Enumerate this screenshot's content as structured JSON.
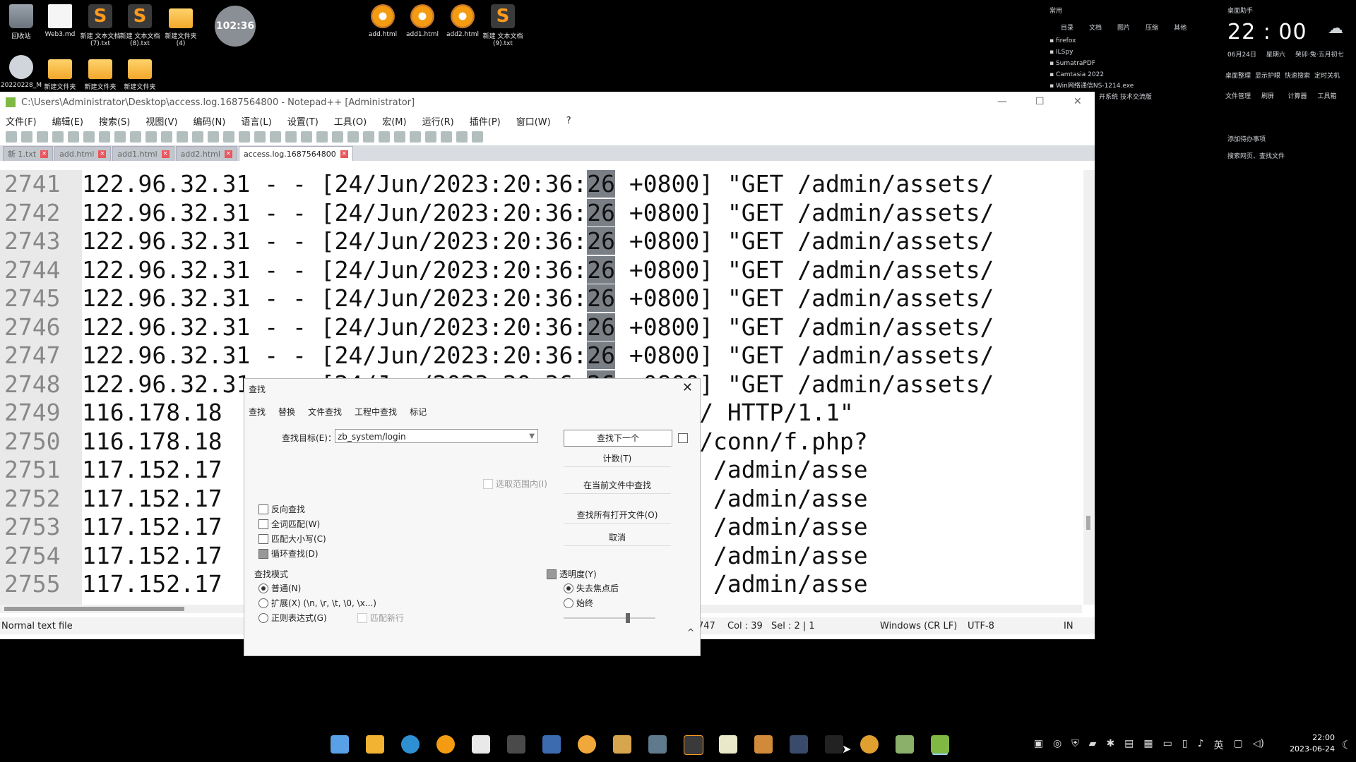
{
  "desktop": {
    "icons": [
      {
        "label": "回收站",
        "kind": "trash"
      },
      {
        "label": "Web3.md",
        "kind": "doc"
      },
      {
        "label": "新建 文本文档 (7).txt",
        "kind": "sublime"
      },
      {
        "label": "新建 文本文档 (8).txt",
        "kind": "sublime"
      },
      {
        "label": "新建文件夹 (4)",
        "kind": "folder"
      },
      {
        "label": "add.html",
        "kind": "chrome"
      },
      {
        "label": "add1.html",
        "kind": "chrome"
      },
      {
        "label": "add2.html",
        "kind": "chrome"
      },
      {
        "label": "新建 文本文档 (9).txt",
        "kind": "sublime"
      },
      {
        "label": "20220228_M",
        "kind": "zip"
      },
      {
        "label": "新建文件夹",
        "kind": "folder"
      },
      {
        "label": "新建文件夹",
        "kind": "folder"
      },
      {
        "label": "新建文件夹",
        "kind": "folder"
      }
    ],
    "clock_bubble": "102:36"
  },
  "widget": {
    "header": "常用",
    "tabs": [
      "目录",
      "文档",
      "图片",
      "压缩",
      "其他"
    ],
    "apps": [
      "firefox",
      "ILSpy",
      "SumatraPDF",
      "Camtasia 2022",
      "Win网络通信NS-1214.exe"
    ],
    "title": "桌面助手",
    "time": "22 : 00",
    "date": "06月24日",
    "weekday": "星期六",
    "lunar": "癸卯·兔·五月初七",
    "tools": [
      "桌面整理",
      "显示护眼",
      "快速搜索",
      "定时关机",
      "文件管理",
      "刷屏",
      "计算器",
      "工具箱"
    ],
    "note1": "添加待办事项",
    "note2": "搜索网页、查找文件",
    "side_text": "开系统 技术交流版"
  },
  "window": {
    "title": "C:\\Users\\Administrator\\Desktop\\access.log.1687564800 - Notepad++ [Administrator]",
    "menu": [
      "文件(F)",
      "编辑(E)",
      "搜索(S)",
      "视图(V)",
      "编码(N)",
      "语言(L)",
      "设置(T)",
      "工具(O)",
      "宏(M)",
      "运行(R)",
      "插件(P)",
      "窗口(W)",
      "?"
    ],
    "tabs": [
      {
        "label": "新 1.txt",
        "active": false
      },
      {
        "label": "add.html",
        "active": false
      },
      {
        "label": "add1.html",
        "active": false
      },
      {
        "label": "add2.html",
        "active": false
      },
      {
        "label": "access.log.1687564800",
        "active": true
      }
    ],
    "lines": [
      {
        "num": "2741",
        "pre": "122.96.32.31 - - [24/Jun/2023:20:36:",
        "hl": "26",
        "post": " +0800] \"GET /admin/assets/"
      },
      {
        "num": "2742",
        "pre": "122.96.32.31 - - [24/Jun/2023:20:36:",
        "hl": "26",
        "post": " +0800] \"GET /admin/assets/"
      },
      {
        "num": "2743",
        "pre": "122.96.32.31 - - [24/Jun/2023:20:36:",
        "hl": "26",
        "post": " +0800] \"GET /admin/assets/"
      },
      {
        "num": "2744",
        "pre": "122.96.32.31 - - [24/Jun/2023:20:36:",
        "hl": "26",
        "post": " +0800] \"GET /admin/assets/"
      },
      {
        "num": "2745",
        "pre": "122.96.32.31 - - [24/Jun/2023:20:36:",
        "hl": "26",
        "post": " +0800] \"GET /admin/assets/"
      },
      {
        "num": "2746",
        "pre": "122.96.32.31 - - [24/Jun/2023:20:36:",
        "hl": "26",
        "post": " +0800] \"GET /admin/assets/"
      },
      {
        "num": "2747",
        "pre": "122.96.32.31 - - [24/Jun/2023:20:36:",
        "hl": "26",
        "post": " +0800] \"GET /admin/assets/"
      },
      {
        "num": "2748",
        "pre": "122.96.32.31 - - [24/Jun/2023:20:36:",
        "hl": "26",
        "post": " +0800] \"GET /admin/assets/"
      },
      {
        "num": "2749",
        "pre": "116.178.18",
        "hl": "",
        "post": "                      +0800] \"GET / HTTP/1.1\""
      },
      {
        "num": "2750",
        "pre": "116.178.18",
        "hl": "",
        "post": "                      +0800] \"GET /conn/f.php?"
      },
      {
        "num": "2751",
        "pre": "117.152.17",
        "hl": "",
        "post": "                     8 +0800] \"GET /admin/asse"
      },
      {
        "num": "2752",
        "pre": "117.152.17",
        "hl": "",
        "post": "                     8 +0800] \"GET /admin/asse"
      },
      {
        "num": "2753",
        "pre": "117.152.17",
        "hl": "",
        "post": "                     8 +0800] \"GET /admin/asse"
      },
      {
        "num": "2754",
        "pre": "117.152.17",
        "hl": "",
        "post": "                     8 +0800] \"GET /admin/asse"
      },
      {
        "num": "2755",
        "pre": "117.152.17",
        "hl": "",
        "post": "                     8 +0800] \"GET /admin/asse"
      }
    ],
    "status": {
      "filetype": "Normal text file",
      "line": "747",
      "col": "Col : 39",
      "sel": "Sel : 2 | 1",
      "eol": "Windows (CR LF)",
      "encoding": "UTF-8",
      "mode": "IN"
    }
  },
  "find_dialog": {
    "title": "查找",
    "tabs": [
      "查找",
      "替换",
      "文件查找",
      "工程中查找",
      "标记"
    ],
    "target_label": "查找目标(E)：",
    "target_value": "zb_system/login",
    "buttons": [
      "查找下一个",
      "计数(T)",
      "在当前文件中查找",
      "查找所有打开文件(O)",
      "取消"
    ],
    "in_selection": "选取范围内(I)",
    "options": [
      {
        "label": "反向查找",
        "checked": false
      },
      {
        "label": "全词匹配(W)",
        "checked": false
      },
      {
        "label": "匹配大小写(C)",
        "checked": false
      },
      {
        "label": "循环查找(D)",
        "checked": true
      }
    ],
    "mode_title": "查找模式",
    "modes": [
      {
        "label": "普通(N)",
        "checked": true
      },
      {
        "label": "扩展(X) (\\n, \\r, \\t, \\0, \\x...)",
        "checked": false
      },
      {
        "label": "正则表达式(G)",
        "checked": false
      }
    ],
    "match_newline": "匹配新行",
    "transparency": "透明度(Y)",
    "trans_options": [
      {
        "label": "失去焦点后",
        "checked": true
      },
      {
        "label": "始终",
        "checked": false
      }
    ],
    "transparency_level": 0.7
  },
  "taskbar": {
    "time": "22:00",
    "date": "2023-06-24",
    "ime": "英"
  }
}
